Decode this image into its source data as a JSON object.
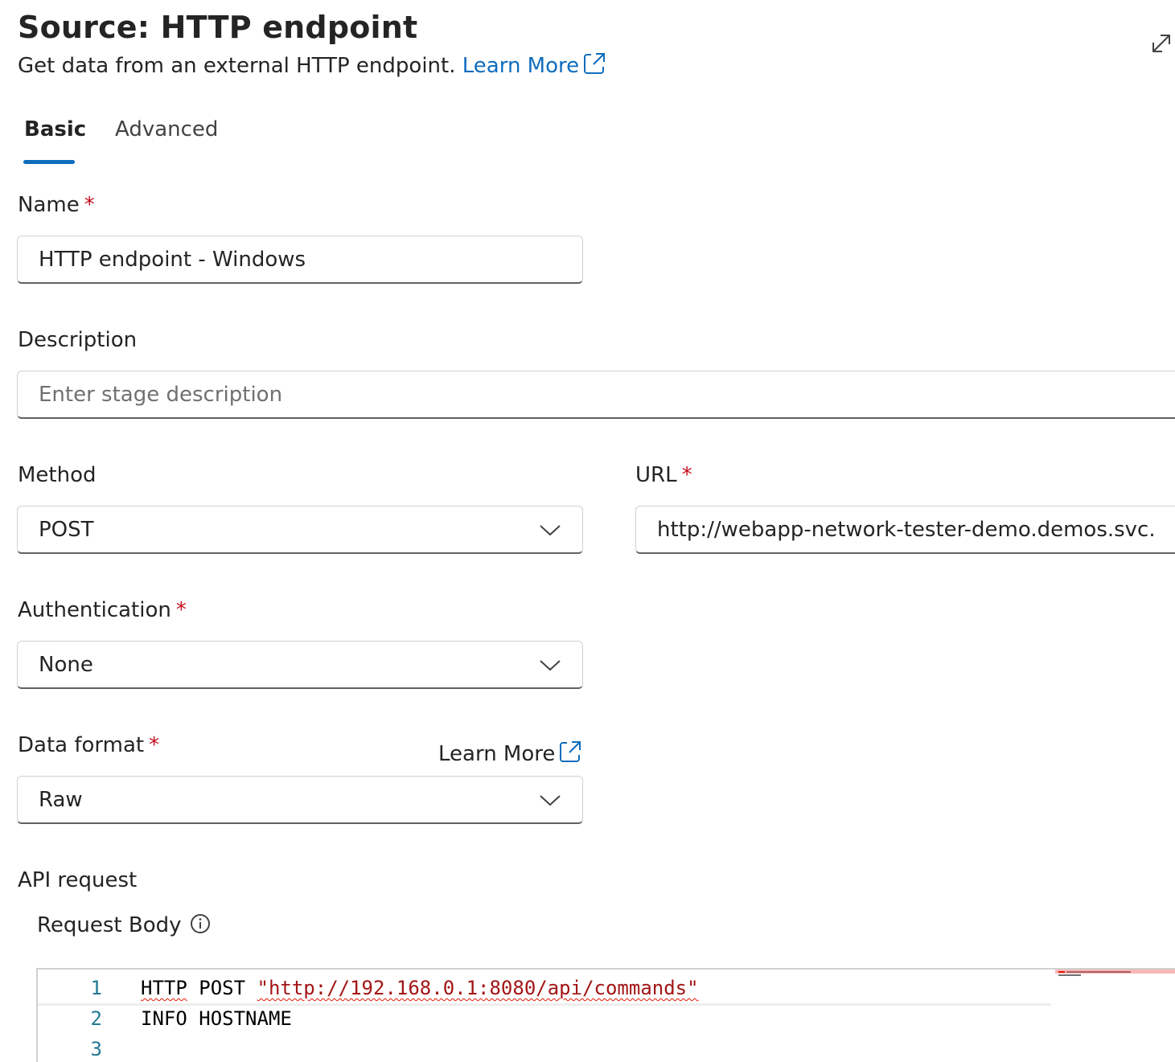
{
  "header": {
    "title": "Source: HTTP endpoint",
    "subtitle": "Get data from an external HTTP endpoint.",
    "learn_more": "Learn More"
  },
  "tabs": [
    {
      "label": "Basic",
      "selected": true
    },
    {
      "label": "Advanced",
      "selected": false
    }
  ],
  "form": {
    "name": {
      "label": "Name",
      "required": "*",
      "value": "HTTP endpoint - Windows"
    },
    "description": {
      "label": "Description",
      "placeholder": "Enter stage description"
    },
    "method": {
      "label": "Method",
      "value": "POST"
    },
    "url": {
      "label": "URL",
      "required": "*",
      "value": "http://webapp-network-tester-demo.demos.svc.clust"
    },
    "authentication": {
      "label": "Authentication",
      "required": "*",
      "value": "None"
    },
    "data_format": {
      "label": "Data format",
      "required": "*",
      "learn_more": "Learn More",
      "value": "Raw"
    }
  },
  "api_request": {
    "section_label": "API request",
    "request_body_label": "Request Body",
    "lines": [
      {
        "number": "1",
        "keyword": "HTTP",
        "rest": " POST ",
        "string": "\"http://192.168.0.1:8080/api/commands\""
      },
      {
        "number": "2",
        "text": "INFO HOSTNAME"
      },
      {
        "number": "3",
        "text": ""
      }
    ]
  },
  "colors": {
    "accent": "#0f6cbd",
    "required": "#c50f1f",
    "code_string": "#a31515",
    "line_number": "#237893"
  },
  "icons": {
    "external_link": "external-link-icon",
    "expand": "expand-icon",
    "chevron": "chevron-down-icon",
    "info": "info-icon"
  }
}
